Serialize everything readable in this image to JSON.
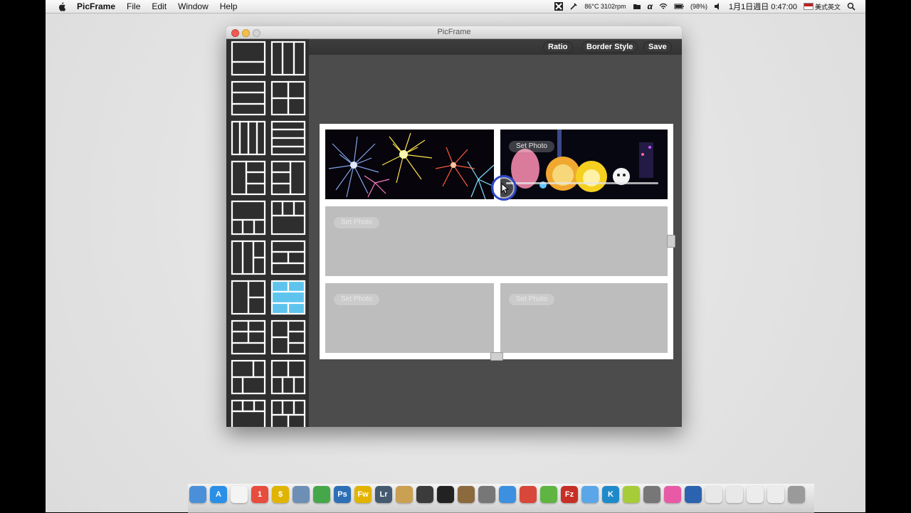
{
  "menubar": {
    "app_name": "PicFrame",
    "items": [
      "File",
      "Edit",
      "Window",
      "Help"
    ],
    "status_temp": "86°C 3102rpm",
    "battery": "(98%)",
    "clock": "1月1日週日  0:47:00",
    "input_source": "美式英文"
  },
  "window": {
    "title": "PicFrame",
    "toolbar": {
      "ratio_label": "Ratio",
      "border_style_label": "Border Style",
      "save_label": "Save"
    },
    "selected_layout_index": 13,
    "cells": [
      {
        "set_photo_label": "Set Photo",
        "photo": "fireworks"
      },
      {
        "set_photo_label": "Set Photo",
        "photo": "lantern-festival"
      },
      {
        "set_photo_label": "Set Photo",
        "photo": "empty"
      },
      {
        "set_photo_label": "Set Photo",
        "photo": "empty"
      },
      {
        "set_photo_label": "Set Photo",
        "photo": "empty"
      }
    ]
  },
  "colors": {
    "selected_layout": "#5ec4ee",
    "sidebar_bg": "#2e2e2e",
    "window_bg": "#4c4c4c",
    "empty_cell": "#bdbdbd"
  },
  "dock": {
    "icons": [
      {
        "name": "finder-icon",
        "glyph": "",
        "color": "#4a90d9"
      },
      {
        "name": "app-store-icon",
        "glyph": "A",
        "color": "#2a8fe6"
      },
      {
        "name": "document-icon",
        "glyph": "",
        "color": "#f4f4f4"
      },
      {
        "name": "calendar-icon",
        "glyph": "1",
        "color": "#e74c3c"
      },
      {
        "name": "money-icon",
        "glyph": "$",
        "color": "#e0b400"
      },
      {
        "name": "preview-icon",
        "glyph": "",
        "color": "#6d8fb5"
      },
      {
        "name": "photos-icon",
        "glyph": "",
        "color": "#46a74a"
      },
      {
        "name": "photoshop-icon",
        "glyph": "Ps",
        "color": "#2d6fb5"
      },
      {
        "name": "fireworks-icon",
        "glyph": "Fw",
        "color": "#e2b400"
      },
      {
        "name": "lightroom-icon",
        "glyph": "Lr",
        "color": "#455a6f"
      },
      {
        "name": "script-icon",
        "glyph": "",
        "color": "#caa052"
      },
      {
        "name": "aperture-icon",
        "glyph": "",
        "color": "#3b3b3b"
      },
      {
        "name": "facetime-icon",
        "glyph": "",
        "color": "#222"
      },
      {
        "name": "image-capture-icon",
        "glyph": "",
        "color": "#8b6b3e"
      },
      {
        "name": "star-icon",
        "glyph": "",
        "color": "#777"
      },
      {
        "name": "safari-icon",
        "glyph": "",
        "color": "#3d8fe0"
      },
      {
        "name": "chrome-icon",
        "glyph": "",
        "color": "#d8473a"
      },
      {
        "name": "leaf-icon",
        "glyph": "",
        "color": "#5fb442"
      },
      {
        "name": "filezilla-icon",
        "glyph": "Fz",
        "color": "#c62f26"
      },
      {
        "name": "itunes-icon",
        "glyph": "",
        "color": "#5aa6e8"
      },
      {
        "name": "k-icon",
        "glyph": "K",
        "color": "#1f8ac9"
      },
      {
        "name": "smile-icon",
        "glyph": "",
        "color": "#a6cc3a"
      },
      {
        "name": "utility-icon",
        "glyph": "",
        "color": "#777"
      },
      {
        "name": "notes-icon",
        "glyph": "",
        "color": "#e85aa6"
      },
      {
        "name": "search-app-icon",
        "glyph": "",
        "color": "#2c63b0"
      },
      {
        "name": "folder-icon",
        "glyph": "",
        "color": "#e8e8e8"
      },
      {
        "name": "folder2-icon",
        "glyph": "",
        "color": "#e8e8e8"
      },
      {
        "name": "font-book-icon",
        "glyph": "",
        "color": "#ececec"
      },
      {
        "name": "apple-folder-icon",
        "glyph": "",
        "color": "#ececec"
      },
      {
        "name": "trash-icon",
        "glyph": "",
        "color": "#9a9a9a"
      }
    ]
  }
}
